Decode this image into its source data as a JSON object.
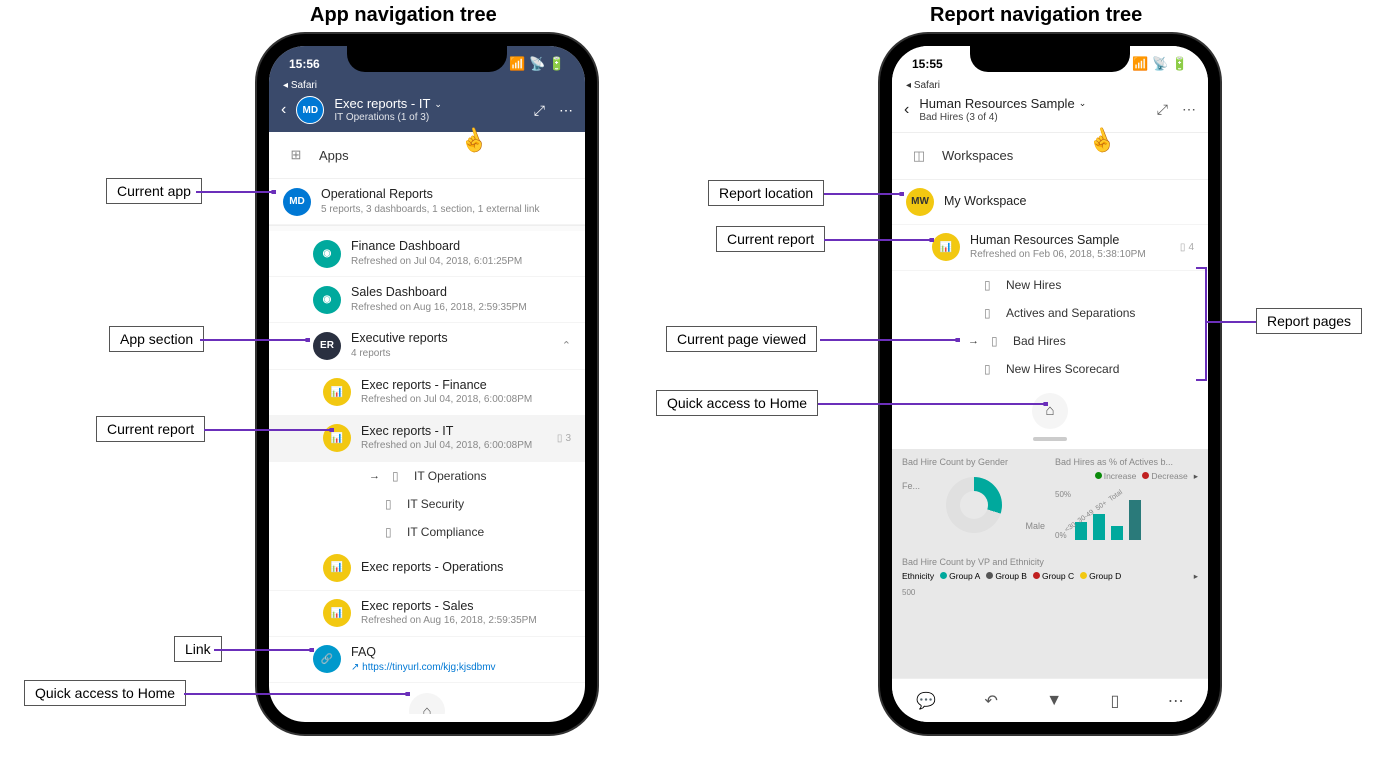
{
  "headings": {
    "left": "App navigation tree",
    "right": "Report navigation tree"
  },
  "annotations": {
    "current_app": "Current app",
    "app_section": "App section",
    "current_report": "Current report",
    "link": "Link",
    "quick_home": "Quick access to Home",
    "report_location": "Report location",
    "current_report_r": "Current report",
    "current_page": "Current page viewed",
    "quick_home_r": "Quick access to Home",
    "report_pages": "Report pages"
  },
  "phone1": {
    "status": {
      "time": "15:56",
      "safari": "Safari"
    },
    "header": {
      "avatar": "MD",
      "title": "Exec reports - IT",
      "subtitle": "IT Operations (1 of 3)"
    },
    "apps_label": "Apps",
    "current_app": {
      "avatar": "MD",
      "title": "Operational Reports",
      "subtitle": "5 reports, 3 dashboards, 1 section, 1 external link"
    },
    "dashboards": [
      {
        "title": "Finance Dashboard",
        "subtitle": "Refreshed on Jul 04, 2018, 6:01:25PM"
      },
      {
        "title": "Sales Dashboard",
        "subtitle": "Refreshed on Aug 16, 2018, 2:59:35PM"
      }
    ],
    "section": {
      "avatar": "ER",
      "title": "Executive reports",
      "subtitle": "4 reports"
    },
    "section_reports": [
      {
        "title": "Exec reports - Finance",
        "subtitle": "Refreshed on Jul 04, 2018, 6:00:08PM",
        "active": false,
        "pages": null
      },
      {
        "title": "Exec reports - IT",
        "subtitle": "Refreshed on Jul 04, 2018, 6:00:08PM",
        "active": true,
        "pages": "3"
      },
      {
        "title": "Exec reports - Operations",
        "subtitle": "",
        "active": false,
        "pages": null
      },
      {
        "title": "Exec reports - Sales",
        "subtitle": "Refreshed on Aug 16, 2018, 2:59:35PM",
        "active": false,
        "pages": null
      }
    ],
    "report_pages": [
      {
        "title": "IT Operations",
        "current": true
      },
      {
        "title": "IT Security",
        "current": false
      },
      {
        "title": "IT Compliance",
        "current": false
      }
    ],
    "link": {
      "title": "FAQ",
      "url": "https://tinyurl.com/kjg;kjsdbmv"
    }
  },
  "phone2": {
    "status": {
      "time": "15:55",
      "safari": "Safari"
    },
    "header": {
      "title": "Human Resources Sample",
      "subtitle": "Bad Hires (3 of 4)"
    },
    "workspaces_label": "Workspaces",
    "workspace": {
      "avatar": "MW",
      "title": "My Workspace"
    },
    "report": {
      "title": "Human Resources Sample",
      "subtitle": "Refreshed on Feb 06, 2018, 5:38:10PM",
      "pages": "4"
    },
    "pages": [
      {
        "title": "New Hires",
        "current": false
      },
      {
        "title": "Actives and Separations",
        "current": false
      },
      {
        "title": "Bad Hires",
        "current": true
      },
      {
        "title": "New Hires Scorecard",
        "current": false
      }
    ],
    "charts": {
      "c1_title": "Bad Hire Count by Gender",
      "c2_title": "Bad Hires as % of Actives b...",
      "legend_increase": "Increase",
      "legend_decrease": "Decrease",
      "donut_fe": "Fe...",
      "donut_male": "Male",
      "y50": "50%",
      "y0": "0%",
      "xcats": [
        "<30",
        "30-49",
        "50+",
        "Total"
      ],
      "c3_title": "Bad Hire Count by VP and Ethnicity",
      "eth_label": "Ethnicity",
      "groups": [
        "Group A",
        "Group B",
        "Group C",
        "Group D"
      ],
      "y500": "500"
    }
  }
}
